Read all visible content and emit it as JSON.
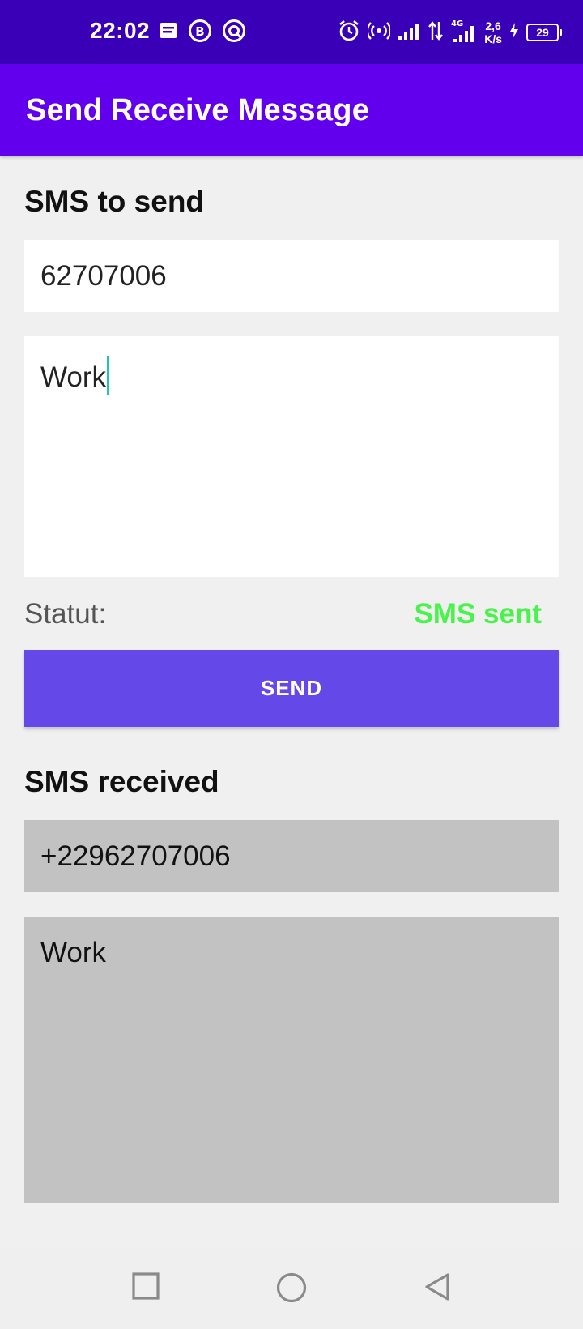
{
  "status_bar": {
    "time": "22:02",
    "left_icons": [
      "message-notification-icon",
      "b-circle-icon",
      "sync-circle-icon"
    ],
    "right_icons": [
      "alarm-icon",
      "hotspot-icon",
      "signal-icon",
      "data-arrows-icon",
      "signal-4g-icon"
    ],
    "net_speed_value": "2,6",
    "net_speed_unit": "K/s",
    "battery": "29",
    "color": "#3a00b8"
  },
  "app_bar": {
    "title": "Send Receive Message",
    "color": "#6200ee"
  },
  "send_section": {
    "title": "SMS to send",
    "phone_value": "62707006",
    "message_value": "Work",
    "status_label": "Statut:",
    "status_value": "SMS sent",
    "status_color": "#4cf24c",
    "send_label": "SEND",
    "button_color": "#6449e8"
  },
  "received_section": {
    "title": "SMS received",
    "phone_value": "+22962707006",
    "message_value": "Work",
    "field_color": "#c2c2c2"
  },
  "nav_bar": {
    "buttons": [
      "recents-square-icon",
      "home-circle-icon",
      "back-triangle-icon"
    ]
  }
}
